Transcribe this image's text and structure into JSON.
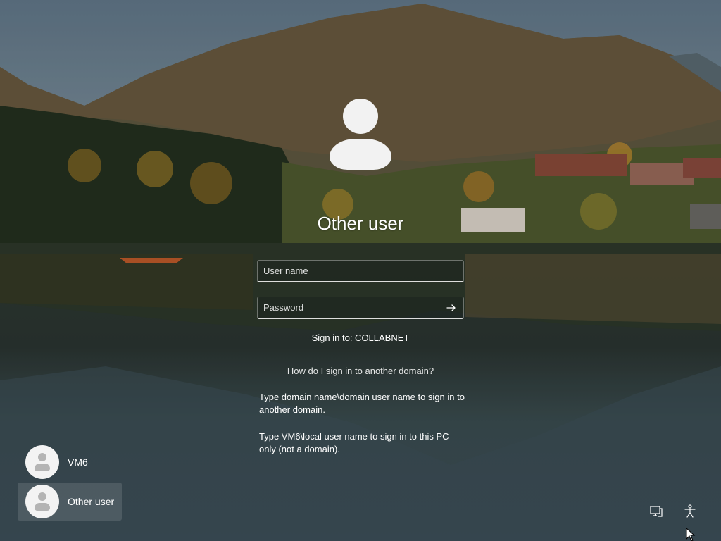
{
  "login": {
    "title": "Other user",
    "username_placeholder": "User name",
    "username_value": "",
    "password_placeholder": "Password",
    "password_value": "",
    "sign_in_to": "Sign in to: COLLABNET",
    "help_link": "How do I sign in to another domain?",
    "help_text_1": "Type domain name\\domain user name to sign in to another domain.",
    "help_text_2": "Type VM6\\local user name to sign in to this PC only (not a domain)."
  },
  "users": [
    {
      "name": "VM6",
      "selected": false
    },
    {
      "name": "Other user",
      "selected": true
    }
  ],
  "icons": {
    "avatar": "user-silhouette-icon",
    "submit": "arrow-right-icon",
    "network": "network-icon",
    "accessibility": "accessibility-icon"
  }
}
